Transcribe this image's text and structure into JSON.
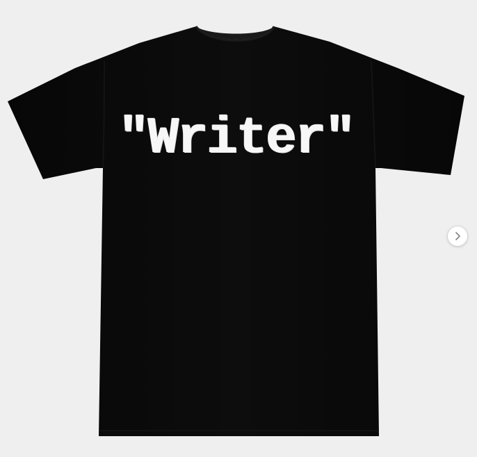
{
  "product": {
    "print_text": "\"Writer\"",
    "shirt_color": "#0a0a0a",
    "background_color": "#efefef",
    "ink_color": "#f7f7f7"
  },
  "carousel": {
    "next_icon": "chevron-right-icon"
  }
}
